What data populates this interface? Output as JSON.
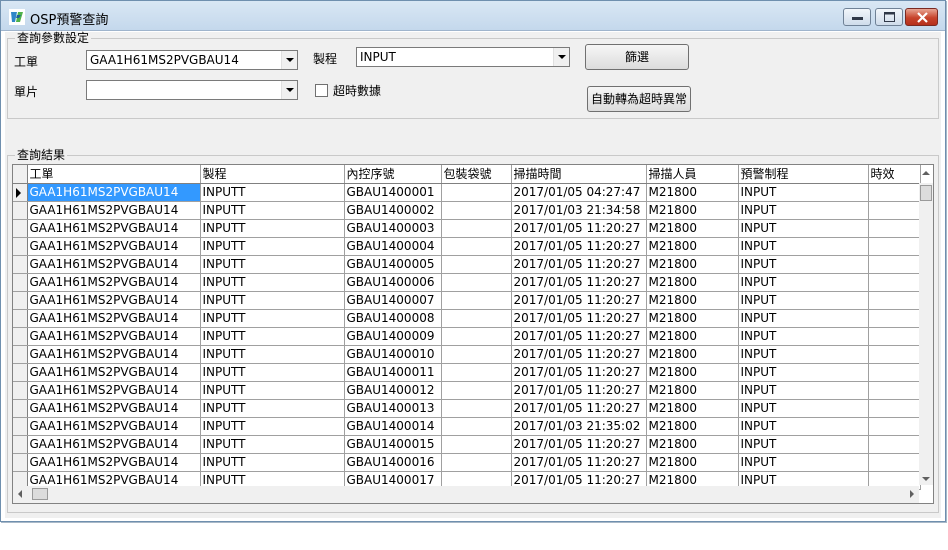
{
  "window": {
    "title": "OSP預警查詢",
    "icon": "app-logo-icon"
  },
  "params": {
    "group_label": "查詢參數設定",
    "work_order_label": "工單",
    "work_order_value": "GAA1H61MS2PVGBAU14",
    "process_label": "製程",
    "process_value": "INPUT",
    "single_piece_label": "單片",
    "single_piece_value": "",
    "timeout_data_label": "超時數據",
    "filter_button": "篩選",
    "auto_exception_button": "自動轉為超時異常"
  },
  "results": {
    "group_label": "查詢結果",
    "columns": [
      "工單",
      "製程",
      "內控序號",
      "包裝袋號",
      "掃描時間",
      "掃描人員",
      "預警制程",
      "時效"
    ],
    "rows": [
      [
        "GAA1H61MS2PVGBAU14",
        "INPUTT",
        "GBAU1400001",
        "",
        "2017/01/05 04:27:47",
        "M21800",
        "INPUT",
        ""
      ],
      [
        "GAA1H61MS2PVGBAU14",
        "INPUTT",
        "GBAU1400002",
        "",
        "2017/01/03 21:34:58",
        "M21800",
        "INPUT",
        ""
      ],
      [
        "GAA1H61MS2PVGBAU14",
        "INPUTT",
        "GBAU1400003",
        "",
        "2017/01/05 11:20:27",
        "M21800",
        "INPUT",
        ""
      ],
      [
        "GAA1H61MS2PVGBAU14",
        "INPUTT",
        "GBAU1400004",
        "",
        "2017/01/05 11:20:27",
        "M21800",
        "INPUT",
        ""
      ],
      [
        "GAA1H61MS2PVGBAU14",
        "INPUTT",
        "GBAU1400005",
        "",
        "2017/01/05 11:20:27",
        "M21800",
        "INPUT",
        ""
      ],
      [
        "GAA1H61MS2PVGBAU14",
        "INPUTT",
        "GBAU1400006",
        "",
        "2017/01/05 11:20:27",
        "M21800",
        "INPUT",
        ""
      ],
      [
        "GAA1H61MS2PVGBAU14",
        "INPUTT",
        "GBAU1400007",
        "",
        "2017/01/05 11:20:27",
        "M21800",
        "INPUT",
        ""
      ],
      [
        "GAA1H61MS2PVGBAU14",
        "INPUTT",
        "GBAU1400008",
        "",
        "2017/01/05 11:20:27",
        "M21800",
        "INPUT",
        ""
      ],
      [
        "GAA1H61MS2PVGBAU14",
        "INPUTT",
        "GBAU1400009",
        "",
        "2017/01/05 11:20:27",
        "M21800",
        "INPUT",
        ""
      ],
      [
        "GAA1H61MS2PVGBAU14",
        "INPUTT",
        "GBAU1400010",
        "",
        "2017/01/05 11:20:27",
        "M21800",
        "INPUT",
        ""
      ],
      [
        "GAA1H61MS2PVGBAU14",
        "INPUTT",
        "GBAU1400011",
        "",
        "2017/01/05 11:20:27",
        "M21800",
        "INPUT",
        ""
      ],
      [
        "GAA1H61MS2PVGBAU14",
        "INPUTT",
        "GBAU1400012",
        "",
        "2017/01/05 11:20:27",
        "M21800",
        "INPUT",
        ""
      ],
      [
        "GAA1H61MS2PVGBAU14",
        "INPUTT",
        "GBAU1400013",
        "",
        "2017/01/05 11:20:27",
        "M21800",
        "INPUT",
        ""
      ],
      [
        "GAA1H61MS2PVGBAU14",
        "INPUTT",
        "GBAU1400014",
        "",
        "2017/01/03 21:35:02",
        "M21800",
        "INPUT",
        ""
      ],
      [
        "GAA1H61MS2PVGBAU14",
        "INPUTT",
        "GBAU1400015",
        "",
        "2017/01/05 11:20:27",
        "M21800",
        "INPUT",
        ""
      ],
      [
        "GAA1H61MS2PVGBAU14",
        "INPUTT",
        "GBAU1400016",
        "",
        "2017/01/05 11:20:27",
        "M21800",
        "INPUT",
        ""
      ],
      [
        "GAA1H61MS2PVGBAU14",
        "INPUTT",
        "GBAU1400017",
        "",
        "2017/01/05 11:20:27",
        "M21800",
        "INPUT",
        ""
      ]
    ],
    "selected_row": 0
  }
}
